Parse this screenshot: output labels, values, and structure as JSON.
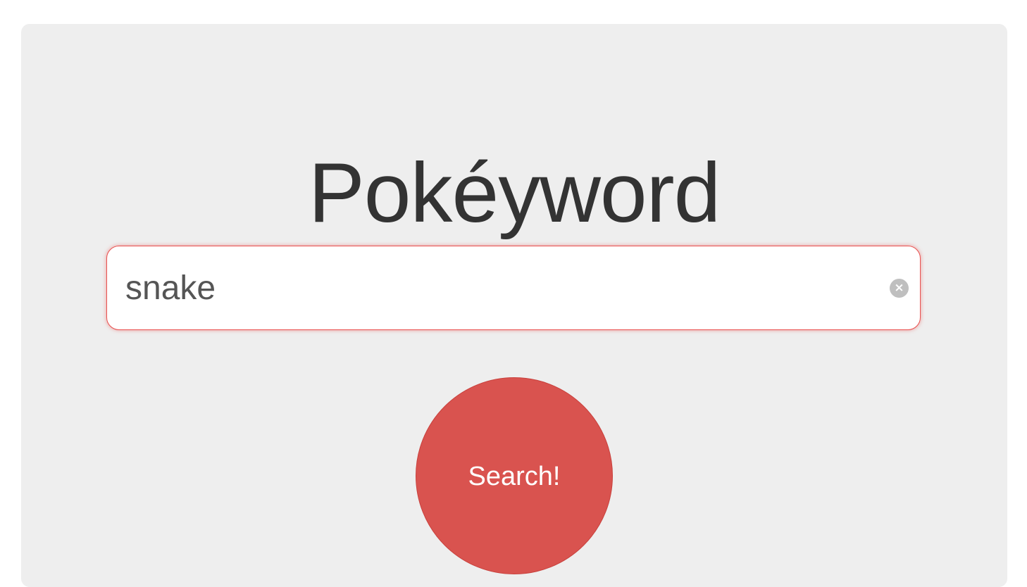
{
  "app": {
    "title": "Pokéyword"
  },
  "search": {
    "value": "snake",
    "clear_icon": "×"
  },
  "actions": {
    "search_label": "Search!"
  },
  "colors": {
    "panel_background": "#eeeeee",
    "accent": "#d9534f",
    "focus_border": "#e9504f",
    "title_text": "#333333"
  }
}
